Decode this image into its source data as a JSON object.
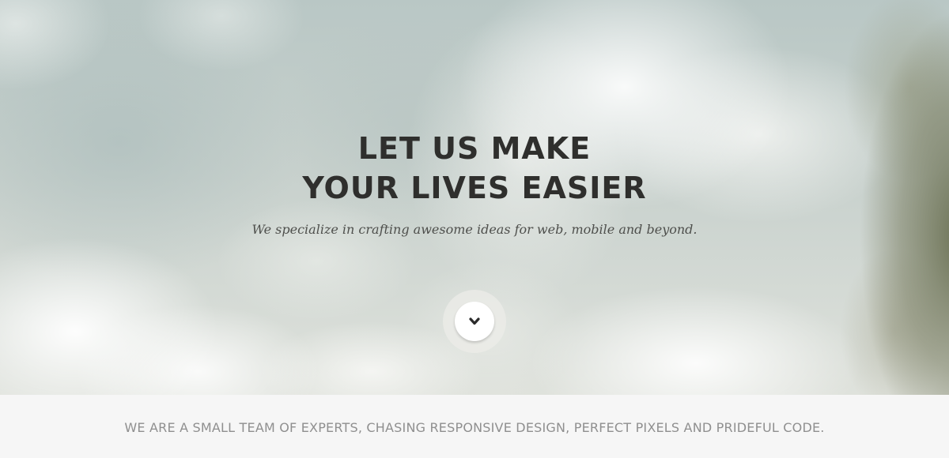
{
  "hero": {
    "title_line1": "LET US MAKE",
    "title_line2": "YOUR LIVES EASIER",
    "subtitle": "We specialize in crafting awesome ideas for web, mobile and beyond.",
    "scroll_icon": "chevron-down-icon"
  },
  "tagline": {
    "text": "WE ARE A SMALL TEAM OF EXPERTS, CHASING RESPONSIVE DESIGN, PERFECT PIXELS AND PRIDEFUL CODE."
  },
  "colors": {
    "title": "#2f2f2d",
    "subtitle": "#4e4f4c",
    "tagline": "#8f8f8f",
    "band_background": "#f6f6f6",
    "button": "#ffffff"
  }
}
